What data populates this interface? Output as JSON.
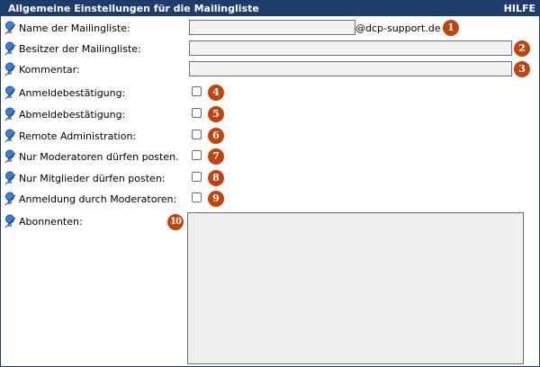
{
  "header": {
    "title": "Allgemeine Einstellungen für die Mailingliste",
    "help": "HILFE"
  },
  "fields": {
    "listname": {
      "label": "Name der Mailingliste:",
      "value": "",
      "suffix": "@dcp-support.de",
      "badge": "1"
    },
    "owner": {
      "label": "Besitzer der Mailingliste:",
      "value": "",
      "badge": "2"
    },
    "comment": {
      "label": "Kommentar:",
      "value": "",
      "badge": "3"
    },
    "subscribe_confirm": {
      "label": "Anmeldebestätigung:",
      "checked": false,
      "badge": "4"
    },
    "unsubscribe_confirm": {
      "label": "Abmeldebestätigung:",
      "checked": false,
      "badge": "5"
    },
    "remote_admin": {
      "label": "Remote Administration:",
      "checked": false,
      "badge": "6"
    },
    "moderators_post": {
      "label": "Nur Moderatoren dürfen posten.",
      "checked": false,
      "badge": "7"
    },
    "members_post": {
      "label": "Nur Mitglieder dürfen posten:",
      "checked": false,
      "badge": "8"
    },
    "moderated_subscribe": {
      "label": "Anmeldung durch Moderatoren:",
      "checked": false,
      "badge": "9"
    },
    "subscribers": {
      "label": "Abonnenten:",
      "value": "",
      "badge": "10"
    }
  },
  "colors": {
    "titlebar": "#1f3d6b",
    "badge": "#c1440e",
    "bulb": "#3d7fd6"
  },
  "icons": {
    "row_marker": "lightbulb-icon"
  }
}
